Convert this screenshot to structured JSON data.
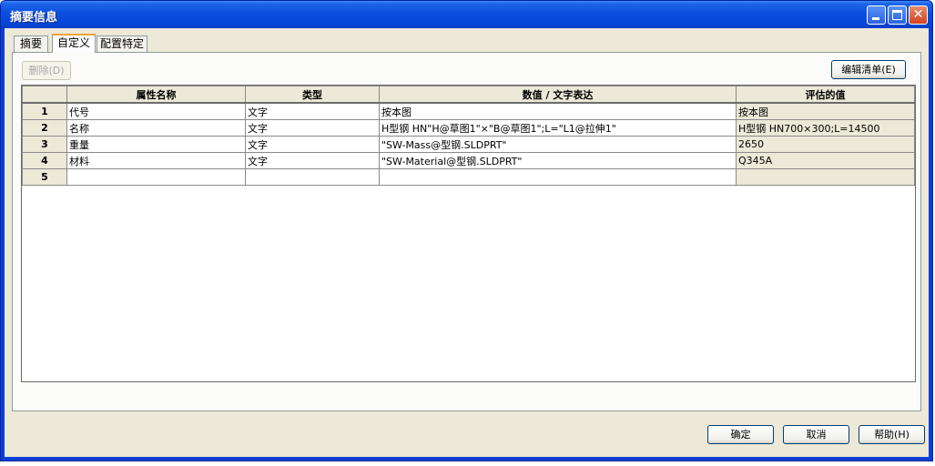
{
  "window": {
    "title": "摘要信息"
  },
  "tabs": [
    {
      "label": "摘要"
    },
    {
      "label": "自定义"
    },
    {
      "label": "配置特定"
    }
  ],
  "toolbar": {
    "delete_label": "删除(D)",
    "edit_list_label": "编辑清单(E)"
  },
  "table": {
    "headers": [
      "",
      "属性名称",
      "类型",
      "数值 / 文字表达",
      "评估的值"
    ],
    "rows": [
      {
        "num": "1",
        "name": "代号",
        "type": "文字",
        "expr": "按本图",
        "value": "按本图"
      },
      {
        "num": "2",
        "name": "名称",
        "type": "文字",
        "expr": "H型钢 HN\"H@草图1\"×\"B@草图1\";L=\"L1@拉伸1\"",
        "value": "H型钢 HN700×300;L=14500"
      },
      {
        "num": "3",
        "name": "重量",
        "type": "文字",
        "expr": "\"SW-Mass@型钢.SLDPRT\"",
        "value": "2650"
      },
      {
        "num": "4",
        "name": "材料",
        "type": "文字",
        "expr": "\"SW-Material@型钢.SLDPRT\"",
        "value": "Q345A"
      },
      {
        "num": "5",
        "name": "",
        "type": "",
        "expr": "",
        "value": ""
      }
    ]
  },
  "footer": {
    "ok_label": "确定",
    "cancel_label": "取消",
    "help_label": "帮助(H)"
  },
  "colors": {
    "titlebar": "#0a4ee0",
    "dialog_bg": "#ece9d8",
    "close_button": "#d0421e",
    "active_tab_accent": "#f1a23a"
  }
}
